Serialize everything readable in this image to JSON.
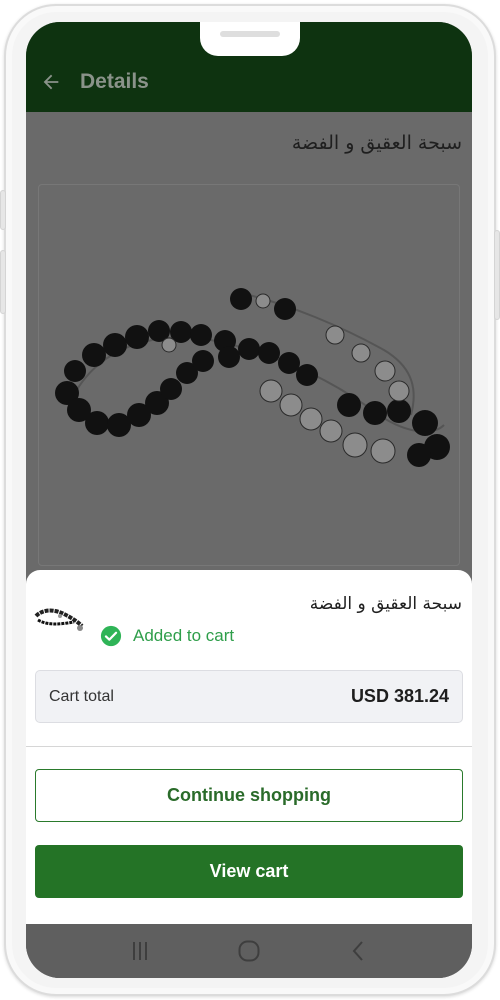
{
  "app_bar": {
    "title": "Details"
  },
  "product": {
    "title": "سبحة العقيق و الفضة"
  },
  "sheet": {
    "product_name": "سبحة العقيق و الفضة",
    "status": "Added to cart",
    "cart_total_label": "Cart total",
    "cart_total_value": "USD 381.24",
    "continue_label": "Continue shopping",
    "view_cart_label": "View cart"
  },
  "icons": {
    "back": "arrow-back-icon",
    "check": "check-circle-icon",
    "nav_recent": "recent-apps-icon",
    "nav_home": "home-icon",
    "nav_back": "nav-back-icon"
  },
  "colors": {
    "app_bar": "#0e3310",
    "accent_green": "#247326",
    "success_green": "#2e9e4a",
    "overlay_gray": "#6a6a6a"
  }
}
